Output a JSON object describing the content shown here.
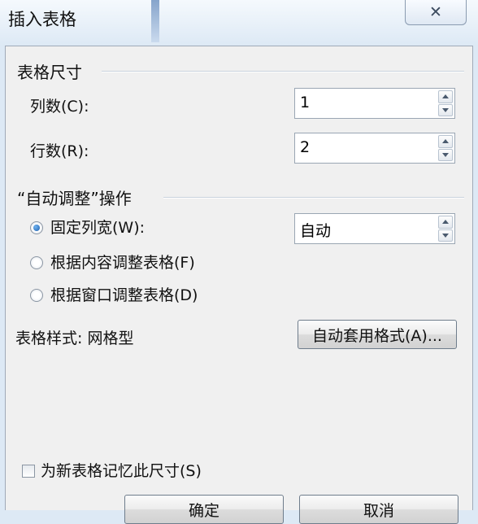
{
  "window": {
    "title": "插入表格",
    "close_glyph": "✕"
  },
  "table_size": {
    "group_label": "表格尺寸",
    "columns_label": "列数(C):",
    "columns_value": "1",
    "rows_label": "行数(R):",
    "rows_value": "2"
  },
  "autofit": {
    "group_label": "“自动调整”操作",
    "fixed_width_label": "固定列宽(W):",
    "fixed_width_value": "自动",
    "fit_content_label": "根据内容调整表格(F)",
    "fit_window_label": "根据窗口调整表格(D)",
    "selected": "fixed_width"
  },
  "table_style": {
    "label": "表格样式: 网格型",
    "autoformat_button": "自动套用格式(A)..."
  },
  "remember": {
    "label": "为新表格记忆此尺寸(S)",
    "checked": false
  },
  "buttons": {
    "ok": "确定",
    "cancel": "取消"
  },
  "icons": {
    "close": "close-icon",
    "spin_up": "spin-up-icon",
    "spin_down": "spin-down-icon"
  }
}
